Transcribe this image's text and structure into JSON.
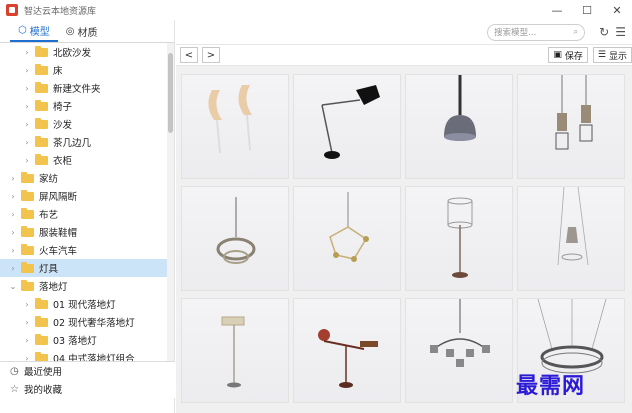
{
  "window": {
    "title": "智达云本地资源库"
  },
  "tabs": [
    {
      "label": "模型",
      "icon": "cube-icon",
      "active": true
    },
    {
      "label": "材质",
      "icon": "palette-icon",
      "active": false
    }
  ],
  "tree": [
    {
      "label": "北欧沙发",
      "level": 1,
      "selected": false
    },
    {
      "label": "床",
      "level": 1,
      "selected": false
    },
    {
      "label": "新建文件夹",
      "level": 1,
      "selected": false
    },
    {
      "label": "椅子",
      "level": 1,
      "selected": false
    },
    {
      "label": "沙发",
      "level": 1,
      "selected": false
    },
    {
      "label": "茶几边几",
      "level": 1,
      "selected": false
    },
    {
      "label": "衣柜",
      "level": 1,
      "selected": false
    },
    {
      "label": "家纺",
      "level": 0,
      "selected": false
    },
    {
      "label": "屏风隔断",
      "level": 0,
      "selected": false
    },
    {
      "label": "布艺",
      "level": 0,
      "selected": false
    },
    {
      "label": "服装鞋帽",
      "level": 0,
      "selected": false
    },
    {
      "label": "火车汽车",
      "level": 0,
      "selected": false
    },
    {
      "label": "灯具",
      "level": 0,
      "selected": true
    },
    {
      "label": "落地灯",
      "level": 0,
      "selected": false,
      "expanded": true
    },
    {
      "label": "01 现代落地灯",
      "level": 1,
      "selected": false
    },
    {
      "label": "02 现代奢华落地灯",
      "level": 1,
      "selected": false
    },
    {
      "label": "03 落地灯",
      "level": 1,
      "selected": false
    },
    {
      "label": "04 中式落地灯组合",
      "level": 1,
      "selected": false
    }
  ],
  "footer": [
    {
      "label": "最近使用",
      "icon": "clock-icon"
    },
    {
      "label": "我的收藏",
      "icon": "star-icon"
    }
  ],
  "toolbar": {
    "search_placeholder": "搜索模型...",
    "back": "<",
    "forward": ">",
    "save_label": "保存",
    "display_label": "显示"
  },
  "watermark": "最需网",
  "colors": {
    "accent": "#1e6fd0",
    "selected": "#cce4f7",
    "folder": "#f2c34d"
  }
}
